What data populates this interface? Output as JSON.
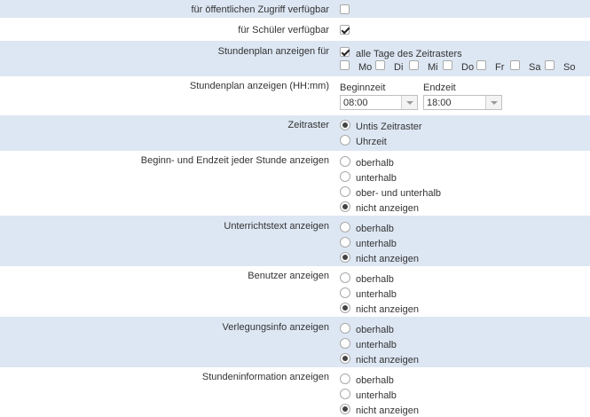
{
  "settings": {
    "public_access": {
      "label": "für öffentlichen Zugriff verfügbar",
      "checked": false
    },
    "students": {
      "label": "für Schüler verfügbar",
      "checked": true
    },
    "show_for": {
      "label": "Stundenplan anzeigen für",
      "all_days_label": "alle Tage des Zeitrasters",
      "all_days_checked": true,
      "days": [
        "Mo",
        "Di",
        "Mi",
        "Do",
        "Fr",
        "Sa",
        "So"
      ]
    },
    "time_range": {
      "label": "Stundenplan anzeigen (HH:mm)",
      "start_label": "Beginnzeit",
      "start_value": "08:00",
      "end_label": "Endzeit",
      "end_value": "18:00"
    },
    "grid": {
      "label": "Zeitraster",
      "options": [
        "Untis Zeitraster",
        "Uhrzeit"
      ],
      "selected": 0
    },
    "begin_end_time": {
      "label": "Beginn- und Endzeit jeder Stunde anzeigen",
      "options": [
        "oberhalb",
        "unterhalb",
        "ober- und unterhalb",
        "nicht anzeigen"
      ],
      "selected": 3
    },
    "lesson_text": {
      "label": "Unterrichtstext anzeigen",
      "options": [
        "oberhalb",
        "unterhalb",
        "nicht anzeigen"
      ],
      "selected": 2
    },
    "user": {
      "label": "Benutzer anzeigen",
      "options": [
        "oberhalb",
        "unterhalb",
        "nicht anzeigen"
      ],
      "selected": 2
    },
    "relocation_info": {
      "label": "Verlegungsinfo anzeigen",
      "options": [
        "oberhalb",
        "unterhalb",
        "nicht anzeigen"
      ],
      "selected": 2
    },
    "lesson_info": {
      "label": "Stundeninformation anzeigen",
      "options": [
        "oberhalb",
        "unterhalb",
        "nicht anzeigen"
      ],
      "selected": 2
    }
  }
}
